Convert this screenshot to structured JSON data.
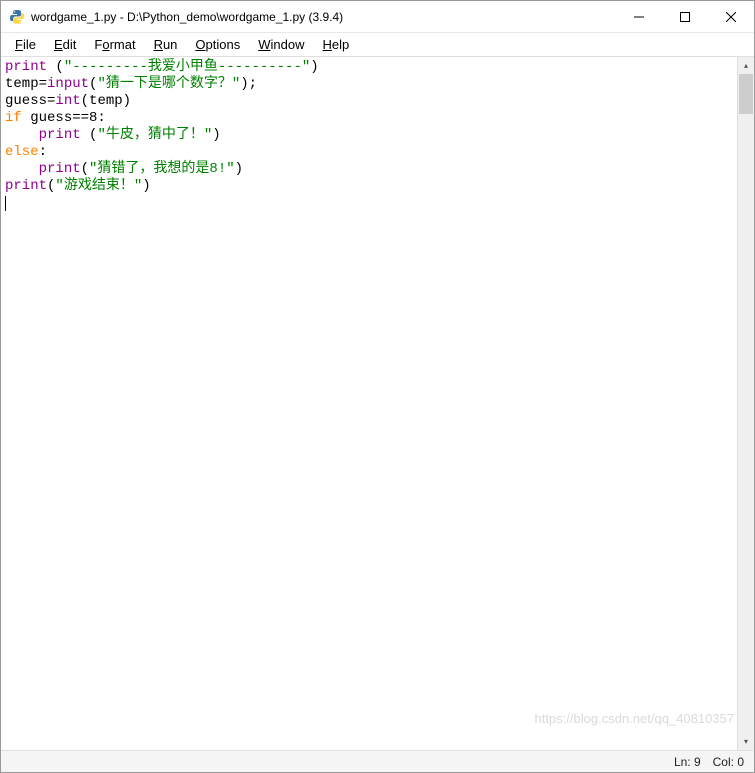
{
  "window": {
    "title": "wordgame_1.py - D:\\Python_demo\\wordgame_1.py (3.9.4)"
  },
  "menu": {
    "file": {
      "label": "File",
      "underline": "F"
    },
    "edit": {
      "label": "Edit",
      "underline": "E"
    },
    "format": {
      "label": "Format",
      "underline": "o"
    },
    "run": {
      "label": "Run",
      "underline": "R"
    },
    "options": {
      "label": "Options",
      "underline": "O"
    },
    "window": {
      "label": "Window",
      "underline": "W"
    },
    "help": {
      "label": "Help",
      "underline": "H"
    }
  },
  "code": {
    "line1": {
      "fn": "print",
      "paren_open": " (",
      "str": "\"---------我爱小甲鱼----------\"",
      "paren_close": ")"
    },
    "line2": {
      "lhs": "temp=",
      "fn": "input",
      "paren_open": "(",
      "str": "\"猜一下是哪个数字？\"",
      "paren_close": ");"
    },
    "line3": {
      "lhs": "guess=",
      "fn": "int",
      "paren_open": "(",
      "arg": "temp",
      "paren_close": ")"
    },
    "line4": {
      "kw": "if",
      "cond": " guess==8:"
    },
    "line5": {
      "indent": "    ",
      "fn": "print",
      "paren_open": " (",
      "str": "\"牛皮，猜中了！\"",
      "paren_close": ")"
    },
    "line6": {
      "kw": "else",
      "colon": ":"
    },
    "line7": {
      "indent": "    ",
      "fn": "print",
      "paren_open": "(",
      "str": "\"猜错了，我想的是8!\"",
      "paren_close": ")"
    },
    "line8": {
      "fn": "print",
      "paren_open": "(",
      "str": "\"游戏结束！\"",
      "paren_close": ")"
    }
  },
  "status": {
    "ln": "Ln: 9",
    "col": "Col: 0"
  },
  "watermark": "https://blog.csdn.net/qq_40810357"
}
